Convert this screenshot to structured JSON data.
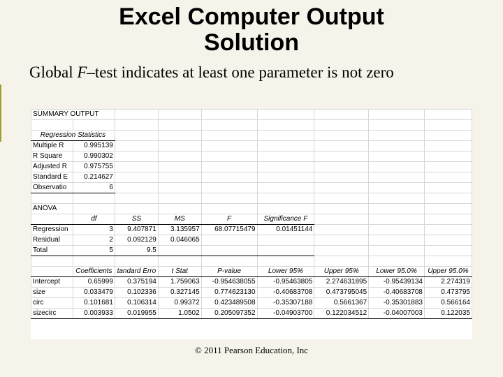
{
  "title_line1": "Excel Computer Output",
  "title_line2": "Solution",
  "subtitle_pre": "Global ",
  "subtitle_f": "F",
  "subtitle_post": "–test indicates at least one parameter is not zero",
  "callouts": {
    "f": "F",
    "p": "P-Value"
  },
  "summary_header": "SUMMARY OUTPUT",
  "regstats_header": "Regression Statistics",
  "regstats": {
    "labels": [
      "Multiple R",
      "R Square",
      "Adjusted R",
      "Standard E",
      "Observatio"
    ],
    "values": [
      "0.995139",
      "0.990302",
      "0.975755",
      "0.214627",
      "6"
    ]
  },
  "anova_header": "ANOVA",
  "anova_cols": [
    "",
    "df",
    "SS",
    "MS",
    "F",
    "Significance F"
  ],
  "anova_rows": [
    {
      "label": "Regression",
      "vals": [
        "3",
        "9.407871",
        "3.135957",
        "68.07715479",
        "0.01451144"
      ]
    },
    {
      "label": "Residual",
      "vals": [
        "2",
        "0.092129",
        "0.046065",
        "",
        ""
      ]
    },
    {
      "label": "Total",
      "vals": [
        "5",
        "9.5",
        "",
        "",
        ""
      ]
    }
  ],
  "coef_cols": [
    "",
    "Coefficients",
    "tandard Erro",
    "t Stat",
    "P-value",
    "Lower 95%",
    "Upper 95%",
    "Lower 95.0%",
    "Upper 95.0%"
  ],
  "coef_rows": [
    {
      "label": "Intercept",
      "vals": [
        "0.65999",
        "0.375194",
        "1.759063",
        "-0.954638055",
        "-0.95463805",
        "2.274631895",
        "-0.95439134",
        "2.274319"
      ]
    },
    {
      "label": "size",
      "vals": [
        "0.033479",
        "0.102336",
        "0.327145",
        "0.774623130",
        "-0.40683708",
        "0.473795045",
        "-0.40683708",
        "0.473795"
      ]
    },
    {
      "label": "circ",
      "vals": [
        "0.101681",
        "0.106314",
        "0.99372",
        "0.423489508",
        "-0.35307188",
        "0.5661367",
        "-0.35301883",
        "0.566164"
      ]
    },
    {
      "label": "sizecirc",
      "vals": [
        "0.003933",
        "0.019955",
        "1.0502",
        "0.205097352",
        "-0.04903700",
        "0.122034512",
        "-0.04007003",
        "0.122035"
      ]
    }
  ],
  "footer": "© 2011 Pearson Education, Inc"
}
